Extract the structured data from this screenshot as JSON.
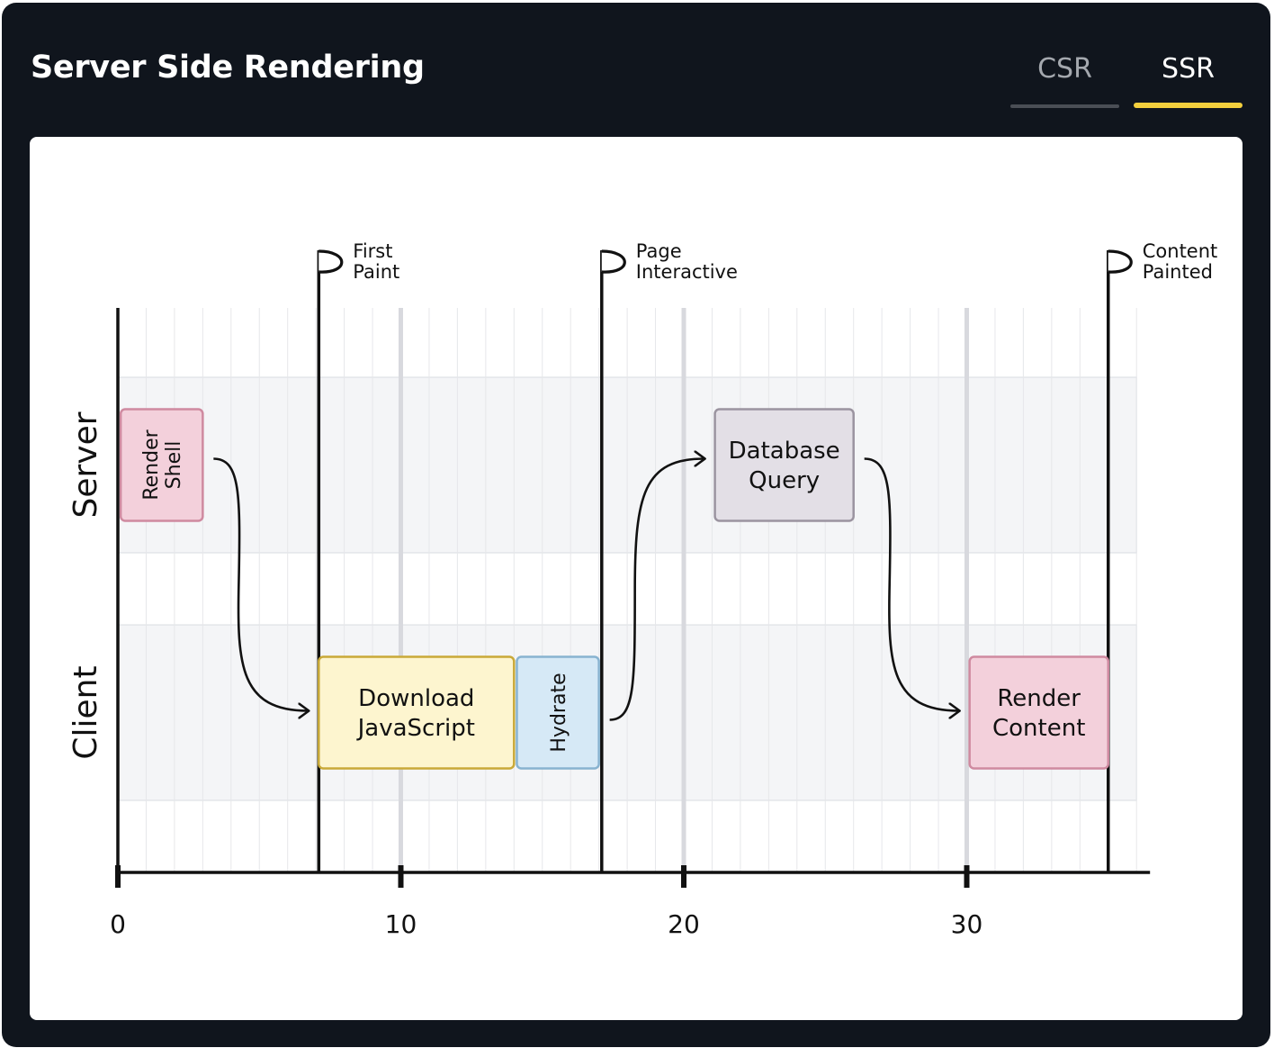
{
  "header": {
    "title": "Server Side Rendering",
    "tabs": [
      {
        "label": "CSR",
        "selected": false
      },
      {
        "label": "SSR",
        "selected": true
      }
    ]
  },
  "colors": {
    "background": "#10151d",
    "accent": "#f3cf3d",
    "server_render": "#f3d0db",
    "download": "#fdf5cf",
    "hydrate": "#d6e9f6",
    "database": "#e3dfe6"
  },
  "diagram": {
    "x_ticks": [
      0,
      10,
      20,
      30
    ],
    "x_max": 36,
    "lanes": [
      {
        "id": "server",
        "label": "Server"
      },
      {
        "id": "client",
        "label": "Client"
      }
    ],
    "milestones": [
      {
        "time": 7.1,
        "lines": [
          "First",
          "Paint"
        ]
      },
      {
        "time": 17.1,
        "lines": [
          "Page",
          "Interactive"
        ]
      },
      {
        "time": 35.0,
        "lines": [
          "Content",
          "Painted"
        ]
      }
    ],
    "tasks": [
      {
        "id": "render-shell",
        "lane": "server",
        "start": 0.1,
        "end": 3.0,
        "lines": [
          "Render",
          "Shell"
        ],
        "vertical": true,
        "fill": "#f3d0db",
        "stroke": "#cf8aa0"
      },
      {
        "id": "download-js",
        "lane": "client",
        "start": 7.1,
        "end": 14.0,
        "lines": [
          "Download",
          "JavaScript"
        ],
        "vertical": false,
        "fill": "#fdf5cf",
        "stroke": "#c9a938"
      },
      {
        "id": "hydrate",
        "lane": "client",
        "start": 14.1,
        "end": 17.0,
        "lines": [
          "Hydrate"
        ],
        "vertical": true,
        "fill": "#d6e9f6",
        "stroke": "#88b3d0"
      },
      {
        "id": "database-query",
        "lane": "server",
        "start": 21.1,
        "end": 26.0,
        "lines": [
          "Database",
          "Query"
        ],
        "vertical": false,
        "fill": "#e3dfe6",
        "stroke": "#9b94a0"
      },
      {
        "id": "render-content",
        "lane": "client",
        "start": 30.1,
        "end": 35.0,
        "lines": [
          "Render",
          "Content"
        ],
        "vertical": false,
        "fill": "#f3d0db",
        "stroke": "#cf8aa0"
      }
    ],
    "arrows": [
      {
        "from": "render-shell",
        "to": "download-js"
      },
      {
        "from": "hydrate",
        "to": "database-query"
      },
      {
        "from": "database-query",
        "to": "render-content"
      }
    ]
  }
}
